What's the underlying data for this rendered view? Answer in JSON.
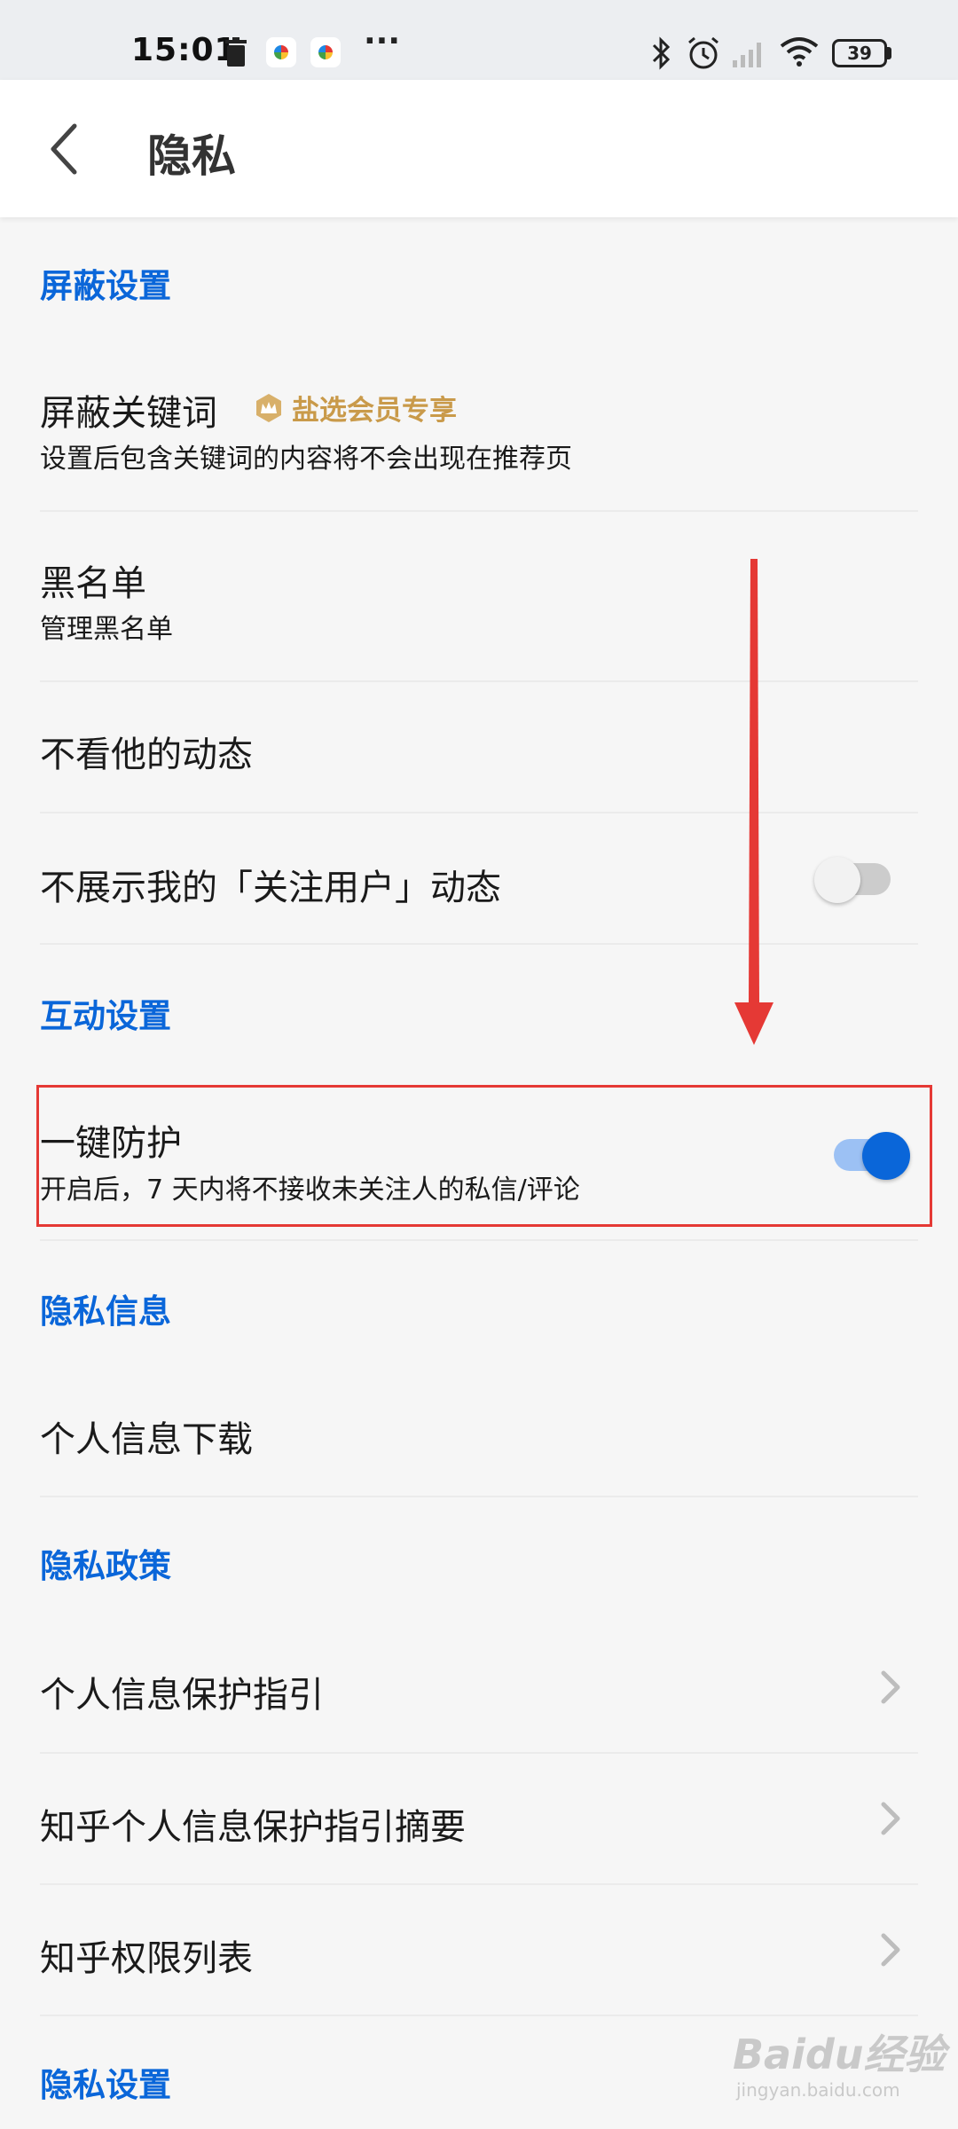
{
  "status_bar": {
    "time": "15:01",
    "battery": "39",
    "more": "···",
    "icons": [
      "trash-icon",
      "app-icon",
      "app-icon",
      "more-icon",
      "bluetooth-icon",
      "alarm-icon",
      "signal-icon",
      "wifi-icon",
      "battery-icon"
    ]
  },
  "header": {
    "title": "隐私",
    "back_icon": "chevron-left-icon"
  },
  "sections": {
    "block": {
      "title": "屏蔽设置",
      "keywords": {
        "title": "屏蔽关键词",
        "badge": "盐选会员专享",
        "subtitle": "设置后包含关键词的内容将不会出现在推荐页"
      },
      "blacklist": {
        "title": "黑名单",
        "subtitle": "管理黑名单"
      },
      "hide_their_feed": {
        "title": "不看他的动态"
      },
      "hide_my_follow": {
        "title": "不展示我的「关注用户」动态",
        "toggle_on": false
      }
    },
    "interaction": {
      "title": "互动设置",
      "one_click_protect": {
        "title": "一键防护",
        "subtitle": "开启后，7 天内将不接收未关注人的私信/评论",
        "toggle_on": true
      }
    },
    "privacy_info": {
      "title": "隐私信息",
      "download": {
        "title": "个人信息下载"
      }
    },
    "privacy_policy": {
      "title": "隐私政策",
      "items": [
        {
          "title": "个人信息保护指引"
        },
        {
          "title": "知乎个人信息保护指引摘要"
        },
        {
          "title": "知乎权限列表"
        }
      ]
    },
    "privacy_settings": {
      "title": "隐私设置"
    }
  },
  "watermark": {
    "main": "Baidu经验",
    "sub": "jingyan.baidu.com"
  },
  "colors": {
    "accent": "#0a66d9",
    "vip_gold": "#c99a4a",
    "annotation_red": "#e53935",
    "background": "#f6f6f6"
  }
}
